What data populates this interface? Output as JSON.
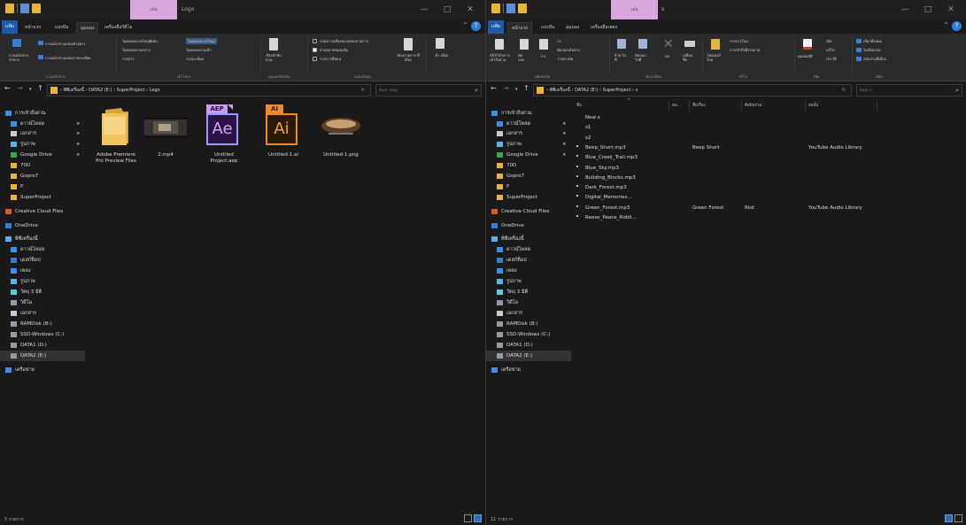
{
  "left": {
    "context_tab": "เล่น",
    "window_title": "Logo",
    "tabs": [
      "แฟ้ม",
      "หน้าแรก",
      "แบ่งปัน",
      "มุมมอง",
      "เครื่องมือวิดีโอ"
    ],
    "ribbon": {
      "pane_top": "บานหน้าต่างแสดงตัวอย่าง",
      "pane_bottom": "บานหน้าต่างแสดงรายละเอียด",
      "nav_pane": "บานหน้าต่าง นำทาง",
      "layout_opts": [
        "ไอคอนขนาดใหญ่พิเศษ",
        "ไอคอนขนาดใหญ่",
        "ไอคอนขนาดกลาง",
        "ไอคอนขนาดเล็ก",
        "รายการ",
        "รายละเอียด"
      ],
      "sort": "เรียงลำดับ ตาม",
      "checks": [
        "กล่องกาเครื่องหมายของรายการ",
        "ส่วนขยายของแฟ้ม",
        "รายการที่ซ่อน"
      ],
      "hide": "ซ่อนรายการ ที่เลือก",
      "options": "ตัว เลือก",
      "groups": [
        "บานหน้าต่าง",
        "เค้าโครง",
        "มุมมองปัจจุบัน",
        "แสดง/ซ่อน"
      ]
    },
    "breadcrumb": [
      "พีซีเครื่องนี้",
      "DATA2 (E:)",
      "SuperProject",
      "Logo"
    ],
    "search_placeholder": "ค้นหา Logo",
    "nav": [
      {
        "label": "การเข้าถึงด่วน",
        "icon": "star-icon",
        "pin": false
      },
      {
        "label": "ดาวน์โหลด",
        "icon": "download-icon",
        "pin": true
      },
      {
        "label": "เอกสาร",
        "icon": "document-icon",
        "pin": true
      },
      {
        "label": "รูปภาพ",
        "icon": "pictures-icon",
        "pin": true
      },
      {
        "label": "Google Drive",
        "icon": "google-drive-icon",
        "pin": true
      },
      {
        "label": "70D",
        "icon": "folder-icon",
        "pin": false
      },
      {
        "label": "Gopro7",
        "icon": "folder-icon",
        "pin": false
      },
      {
        "label": "P",
        "icon": "folder-icon",
        "pin": false
      },
      {
        "label": "SuperProject",
        "icon": "folder-icon",
        "pin": false
      },
      {
        "label": "Creative Cloud Files",
        "icon": "creative-cloud-icon",
        "pin": false
      },
      {
        "label": "OneDrive",
        "icon": "onedrive-icon",
        "pin": false
      },
      {
        "label": "พีซีเครื่องนี้",
        "icon": "this-pc-icon",
        "pin": false
      },
      {
        "label": "ดาวน์โหลด",
        "icon": "download-icon",
        "pin": false
      },
      {
        "label": "เดสก์ท็อป",
        "icon": "desktop-icon",
        "pin": false
      },
      {
        "label": "เพลง",
        "icon": "music-icon",
        "pin": false
      },
      {
        "label": "รูปภาพ",
        "icon": "pictures-icon",
        "pin": false
      },
      {
        "label": "วัตถุ 3 มิติ",
        "icon": "3d-objects-icon",
        "pin": false
      },
      {
        "label": "วิดีโอ",
        "icon": "video-icon",
        "pin": false
      },
      {
        "label": "เอกสาร",
        "icon": "document-icon",
        "pin": false
      },
      {
        "label": "RAMDisk (B:)",
        "icon": "drive-icon",
        "pin": false
      },
      {
        "label": "SSD-Windows (C:)",
        "icon": "drive-icon",
        "pin": false
      },
      {
        "label": "DATA1 (D:)",
        "icon": "drive-icon",
        "pin": false
      },
      {
        "label": "DATA2 (E:)",
        "icon": "drive-icon",
        "pin": false
      },
      {
        "label": "เครือข่าย",
        "icon": "network-icon",
        "pin": false
      }
    ],
    "files": [
      {
        "name": "Adobe Premiere Pro Preview Files",
        "type": "folder"
      },
      {
        "name": "2.mp4",
        "type": "video"
      },
      {
        "name": "Untitled Project.aep",
        "type": "aep",
        "badge": "AEP",
        "glyph": "Ae"
      },
      {
        "name": "Untitled-1.ai",
        "type": "ai",
        "badge": "AI",
        "glyph": "Ai"
      },
      {
        "name": "Untitled-1.png",
        "type": "png"
      }
    ],
    "status": "5 รายการ"
  },
  "right": {
    "context_tab": "เล่น",
    "window_title": "s",
    "tabs": [
      "แฟ้ม",
      "หน้าแรก",
      "แบ่งปัน",
      "มุมมอง",
      "เครื่องมือเพลง"
    ],
    "ribbon": {
      "pin": "ตรึงไว้กับการ เข้าถึงด่วน",
      "copy": "คัด ลอก",
      "paste": "วาง",
      "cut": "ตัด",
      "copy_path": "คัดลอกเส้นทาง",
      "paste_shortcut": "วางทางลัด",
      "move": "ย้าย ไปที่",
      "copy_to": "คัดลอก ไปที่",
      "delete": "ลบ",
      "rename": "เปลี่ยน ชื่อ",
      "new_folder": "โฟลเดอร์ ใหม่",
      "new_item": "รายการใหม่",
      "easy_access": "การเข้าถึงที่ง่ายดาย",
      "properties": "คุณสมบัติ",
      "open": "เปิด",
      "edit": "แก้ไข",
      "history": "ประวัติ",
      "select_all": "เลือกทั้งหมด",
      "select_none": "ไม่เลือกเลย",
      "invert": "สลับส่วนที่เลือก",
      "groups": [
        "คลิปบอร์ด",
        "จัดระเบียบ",
        "สร้าง",
        "เปิด",
        "เลือก"
      ]
    },
    "breadcrumb": [
      "พีซีเครื่องนี้",
      "DATA2 (E:)",
      "SuperProject",
      "s"
    ],
    "search_placeholder": "ค้นหา s",
    "nav": [
      {
        "label": "การเข้าถึงด่วน",
        "icon": "star-icon",
        "pin": false
      },
      {
        "label": "ดาวน์โหลด",
        "icon": "download-icon",
        "pin": true
      },
      {
        "label": "เอกสาร",
        "icon": "document-icon",
        "pin": true
      },
      {
        "label": "รูปภาพ",
        "icon": "pictures-icon",
        "pin": true
      },
      {
        "label": "Google Drive",
        "icon": "google-drive-icon",
        "pin": true
      },
      {
        "label": "70D",
        "icon": "folder-icon",
        "pin": false
      },
      {
        "label": "Gopro7",
        "icon": "folder-icon",
        "pin": false
      },
      {
        "label": "P",
        "icon": "folder-icon",
        "pin": false
      },
      {
        "label": "SuperProject",
        "icon": "folder-icon",
        "pin": false
      },
      {
        "label": "Creative Cloud Files",
        "icon": "creative-cloud-icon",
        "pin": false
      },
      {
        "label": "OneDrive",
        "icon": "onedrive-icon",
        "pin": false
      },
      {
        "label": "พีซีเครื่องนี้",
        "icon": "this-pc-icon",
        "pin": false
      },
      {
        "label": "ดาวน์โหลด",
        "icon": "download-icon",
        "pin": false
      },
      {
        "label": "เดสก์ท็อป",
        "icon": "desktop-icon",
        "pin": false
      },
      {
        "label": "เพลง",
        "icon": "music-icon",
        "pin": false
      },
      {
        "label": "รูปภาพ",
        "icon": "pictures-icon",
        "pin": false
      },
      {
        "label": "วัตถุ 3 มิติ",
        "icon": "3d-objects-icon",
        "pin": false
      },
      {
        "label": "วิดีโอ",
        "icon": "video-icon",
        "pin": false
      },
      {
        "label": "เอกสาร",
        "icon": "document-icon",
        "pin": false
      },
      {
        "label": "RAMDisk (B:)",
        "icon": "drive-icon",
        "pin": false
      },
      {
        "label": "SSD-Windows (C:)",
        "icon": "drive-icon",
        "pin": false
      },
      {
        "label": "DATA1 (D:)",
        "icon": "drive-icon",
        "pin": false
      },
      {
        "label": "DATA2 (E:)",
        "icon": "drive-icon",
        "pin": false
      },
      {
        "label": "เครือข่าย",
        "icon": "network-icon",
        "pin": false
      }
    ],
    "columns": [
      "ชื่อ",
      "หม...",
      "ชื่อเรื่อง",
      "ศิลปินร่วม",
      "อัลบั้ม"
    ],
    "rows": [
      {
        "name": "New s",
        "type": "folder",
        "title": "",
        "artist": "",
        "album": ""
      },
      {
        "name": "s1",
        "type": "folder",
        "title": "",
        "artist": "",
        "album": ""
      },
      {
        "name": "s2",
        "type": "folder",
        "title": "",
        "artist": "",
        "album": ""
      },
      {
        "name": "Beep_Short.mp3",
        "type": "mp3",
        "title": "Beep Short",
        "artist": "",
        "album": "YouTube Audio Library"
      },
      {
        "name": "Blue_Creek_Trail.mp3",
        "type": "mp3",
        "title": "",
        "artist": "",
        "album": ""
      },
      {
        "name": "Blue_Sky.mp3",
        "type": "mp3",
        "title": "",
        "artist": "",
        "album": ""
      },
      {
        "name": "Building_Blocks.mp3",
        "type": "mp3",
        "title": "",
        "artist": "",
        "album": ""
      },
      {
        "name": "Dark_Forest.mp3",
        "type": "mp3",
        "title": "",
        "artist": "",
        "album": ""
      },
      {
        "name": "Digital_Memories...",
        "type": "mp3",
        "title": "",
        "artist": "",
        "album": ""
      },
      {
        "name": "Green_Forest.mp3",
        "type": "mp3",
        "title": "Green Forest",
        "artist": "Riot",
        "album": "YouTube Audio Library"
      },
      {
        "name": "Reese_Peace_Riddi...",
        "type": "mp3",
        "title": "",
        "artist": "",
        "album": ""
      }
    ],
    "status": "11 รายการ"
  },
  "colors": {
    "bg": "#191919",
    "ribbon": "#2b2b2b",
    "file_tab": "#1a5aa8",
    "context": "#d9a7de",
    "folder": "#e8b43a",
    "accent": "#2f7fd8"
  }
}
